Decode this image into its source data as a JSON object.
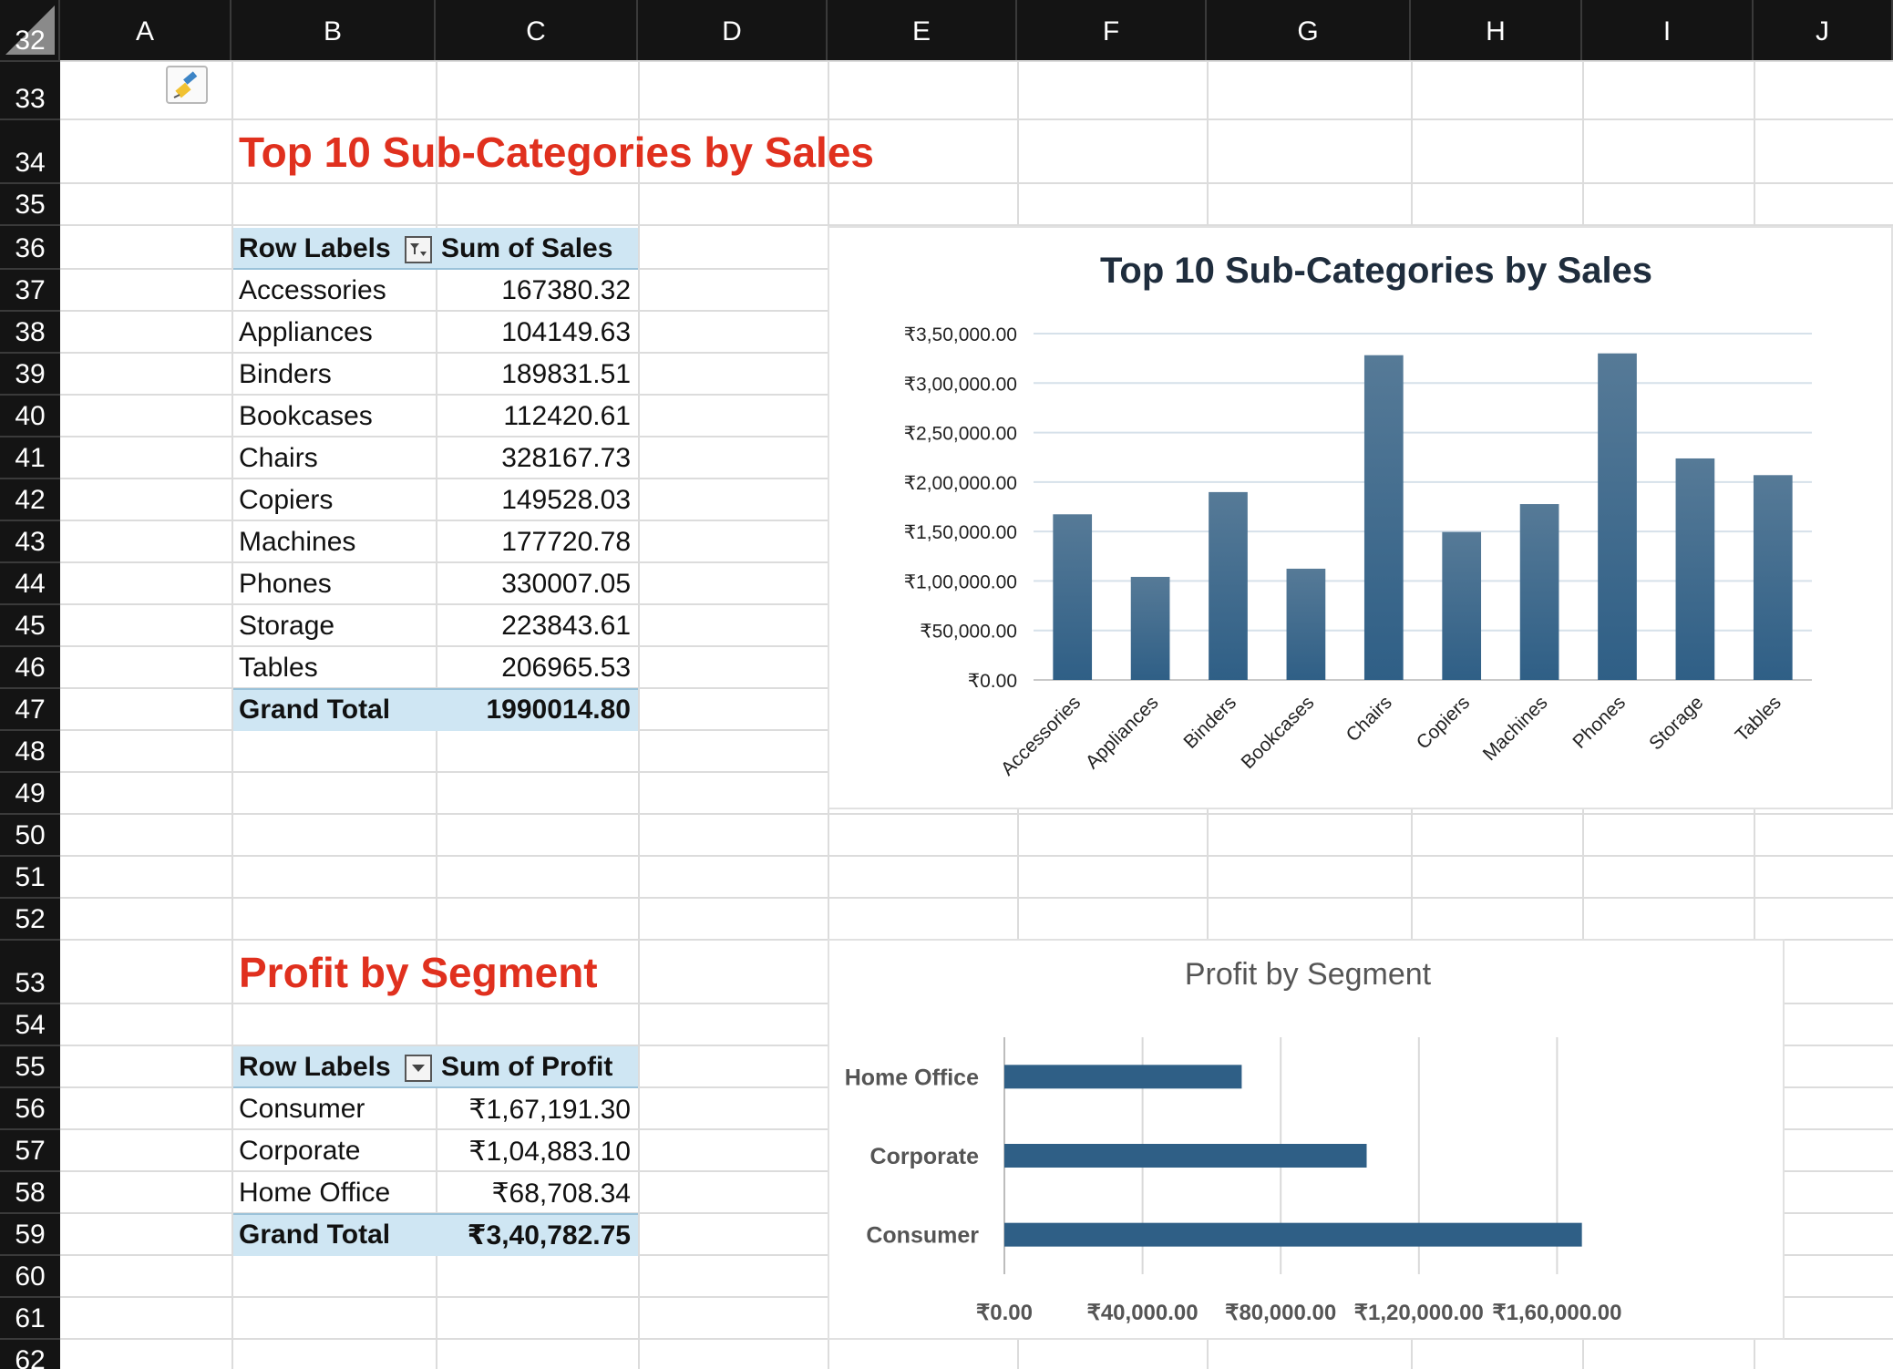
{
  "columns": [
    "A",
    "B",
    "C",
    "D",
    "E",
    "F",
    "G",
    "H",
    "I",
    "J"
  ],
  "rows": [
    "32",
    "33",
    "34",
    "35",
    "36",
    "37",
    "38",
    "39",
    "40",
    "41",
    "42",
    "43",
    "44",
    "45",
    "46",
    "47",
    "48",
    "49",
    "50",
    "51",
    "52",
    "53",
    "54",
    "55",
    "56",
    "57",
    "58",
    "59",
    "60",
    "61",
    "62"
  ],
  "sales_section": {
    "title": "Top 10 Sub-Categories by Sales",
    "pivot": {
      "header_label": "Row Labels",
      "header_value": "Sum of Sales",
      "rows": [
        {
          "label": "Accessories",
          "value": "167380.32"
        },
        {
          "label": "Appliances",
          "value": "104149.63"
        },
        {
          "label": "Binders",
          "value": "189831.51"
        },
        {
          "label": "Bookcases",
          "value": "112420.61"
        },
        {
          "label": "Chairs",
          "value": "328167.73"
        },
        {
          "label": "Copiers",
          "value": "149528.03"
        },
        {
          "label": "Machines",
          "value": "177720.78"
        },
        {
          "label": "Phones",
          "value": "330007.05"
        },
        {
          "label": "Storage",
          "value": "223843.61"
        },
        {
          "label": "Tables",
          "value": "206965.53"
        }
      ],
      "total_label": "Grand Total",
      "total_value": "1990014.80"
    }
  },
  "profit_section": {
    "title": "Profit by Segment",
    "pivot": {
      "header_label": "Row Labels",
      "header_value": "Sum of Profit",
      "rows": [
        {
          "label": "Consumer",
          "value": "₹1,67,191.30"
        },
        {
          "label": "Corporate",
          "value": "₹1,04,883.10"
        },
        {
          "label": "Home Office",
          "value": "₹68,708.34"
        }
      ],
      "total_label": "Grand Total",
      "total_value": "₹3,40,782.75"
    }
  },
  "chart_data": [
    {
      "type": "bar",
      "title": "Top 10 Sub-Categories by Sales",
      "categories": [
        "Accessories",
        "Appliances",
        "Binders",
        "Bookcases",
        "Chairs",
        "Copiers",
        "Machines",
        "Phones",
        "Storage",
        "Tables"
      ],
      "values": [
        167380.32,
        104149.63,
        189831.51,
        112420.61,
        328167.73,
        149528.03,
        177720.78,
        330007.05,
        223843.61,
        206965.53
      ],
      "ylim": [
        0,
        350000
      ],
      "ytick_labels": [
        "₹0.00",
        "₹50,000.00",
        "₹1,00,000.00",
        "₹1,50,000.00",
        "₹2,00,000.00",
        "₹2,50,000.00",
        "₹3,00,000.00",
        "₹3,50,000.00"
      ],
      "grid": true,
      "legend": "none",
      "bar_color": "#2f5f86"
    },
    {
      "type": "bar",
      "orientation": "horizontal",
      "title": "Profit by Segment",
      "categories": [
        "Home Office",
        "Corporate",
        "Consumer"
      ],
      "values": [
        68708.34,
        104883.1,
        167191.3
      ],
      "xlim": [
        0,
        200000
      ],
      "xtick_labels": [
        "₹0.00",
        "₹40,000.00",
        "₹80,000.00",
        "₹1,20,000.00",
        "₹1,60,000.00"
      ],
      "grid": true,
      "legend": "none",
      "bar_color": "#2f5f86"
    }
  ],
  "icons": {
    "format_painter": "paintbrush-icon",
    "filter_active": "filter-icon",
    "dropdown": "chevron-down-icon"
  }
}
